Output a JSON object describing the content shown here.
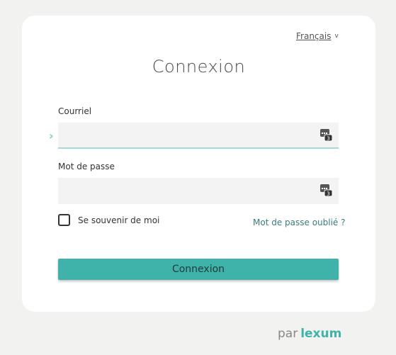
{
  "language": {
    "label": "Français",
    "chevron": "v"
  },
  "title": "Connexion",
  "email": {
    "label": "Courriel",
    "value": "",
    "placeholder": ""
  },
  "password": {
    "label": "Mot de passe",
    "value": "",
    "placeholder": ""
  },
  "remember": {
    "label": "Se souvenir de moi",
    "checked": false
  },
  "forgot_link": "Mot de passe oublié ?",
  "submit_label": "Connexion",
  "footer": {
    "prefix": "par",
    "brand": "lexum"
  },
  "colors": {
    "accent": "#3fb3aa",
    "link": "#3a7a7a",
    "background": "#f2f2f1"
  },
  "icons": {
    "focus_indicator": "chevron-right-icon",
    "password_manager": "password-manager-icon"
  }
}
